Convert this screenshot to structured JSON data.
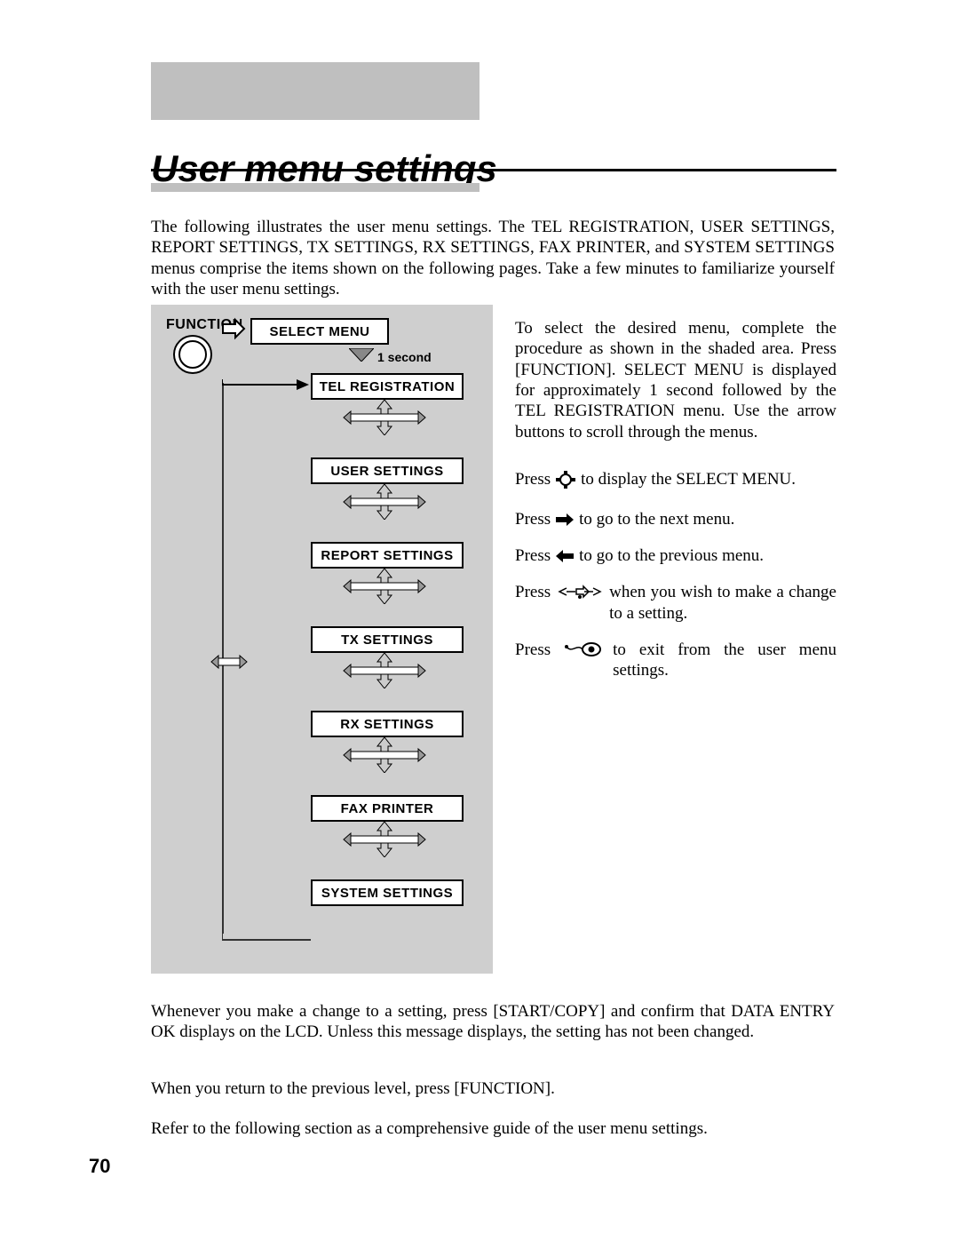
{
  "page_number": "70",
  "title": "User menu settings",
  "intro": "The following illustrates the user menu settings. The TEL REGISTRATION, USER SETTINGS, REPORT SETTINGS, TX SETTINGS, RX SETTINGS, FAX PRINTER, and SYSTEM SETTINGS menus comprise the items shown on the following pages. Take a few minutes to familiarize yourself with the user menu settings.",
  "diagram": {
    "function_label": "FUNCTION",
    "select_menu": "SELECT MENU",
    "timing": "1 second",
    "menus": [
      "TEL REGISTRATION",
      "USER SETTINGS",
      "REPORT SETTINGS",
      "TX SETTINGS",
      "RX SETTINGS",
      "FAX PRINTER",
      "SYSTEM SETTINGS"
    ]
  },
  "right": {
    "p1": "To select the desired menu, complete the procedure as shown in the shaded area. Press [FUNCTION]. SELECT MENU is displayed for approximately 1 second followed by the TEL REGISTRATION menu. Use the arrow buttons to scroll through the menus.",
    "rows": [
      {
        "pre": "Press",
        "post": "to display the SELECT MENU."
      },
      {
        "pre": "Press",
        "post": "to go to the next menu."
      },
      {
        "pre": "Press",
        "post": "to go to the previous menu."
      },
      {
        "pre": "Press",
        "post": "when you wish to make a change to a setting."
      },
      {
        "pre": "Press",
        "post": "to exit from the user menu settings."
      }
    ]
  },
  "bottom": {
    "p1": "Whenever you make a change to a setting, press [START/COPY] and confirm that DATA ENTRY OK displays on the LCD. Unless this message displays, the setting has not been changed.",
    "p2": "When you return to the previous level, press [FUNCTION].",
    "p3": "Refer to the following section as a comprehensive guide of the user menu settings."
  }
}
